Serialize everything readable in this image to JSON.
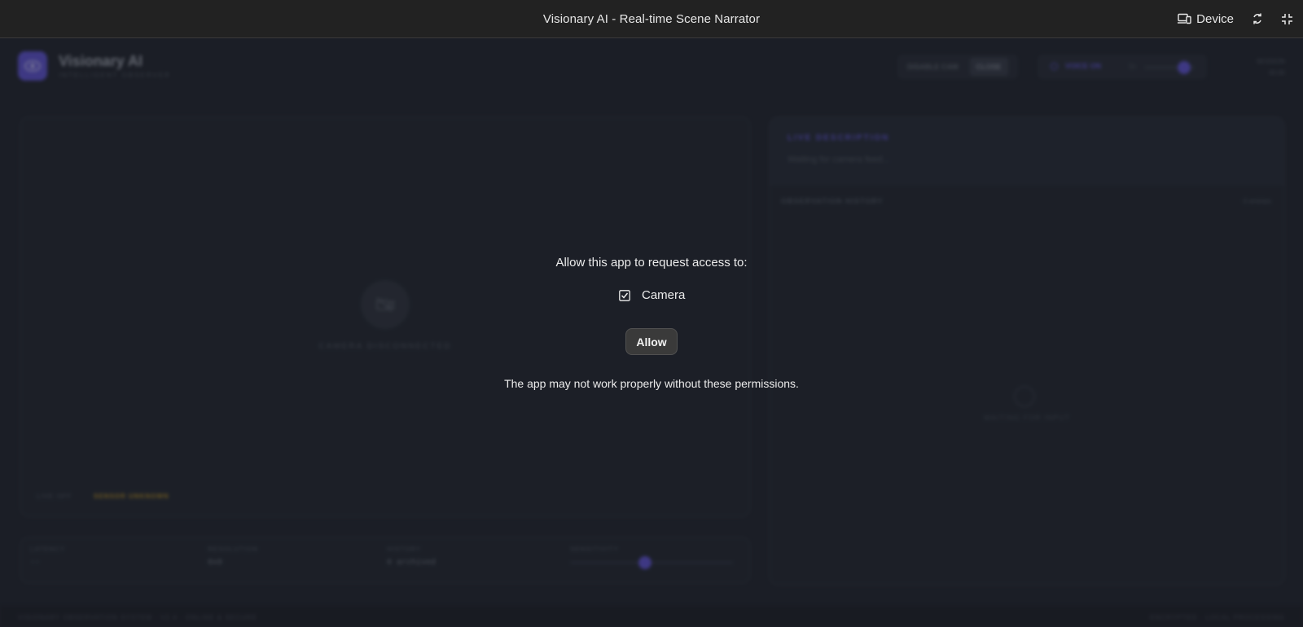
{
  "frame": {
    "title": "Visionary AI - Real-time Scene Narrator",
    "device_label": "Device"
  },
  "app": {
    "brand_name": "Visionary AI",
    "brand_subtitle": "INTELLIGENT OBSERVER",
    "camera_toggle": {
      "options": [
        "DISABLE CAM",
        "CLOSE"
      ]
    },
    "voice_label": "VOICE ON",
    "voice_rate_label": "1x",
    "session_label": "SESSION",
    "session_value": "00:00",
    "camera": {
      "status_text": "CAMERA DISCONNECTED",
      "live_status": "LIVE OFF",
      "sensor_status": "SENSOR UNKNOWN"
    },
    "stats": [
      {
        "label": "LATENCY",
        "value": "--"
      },
      {
        "label": "RESOLUTION",
        "value": "0x0"
      },
      {
        "label": "HISTORY",
        "value": "0 archived"
      },
      {
        "label": "SENSITIVITY",
        "value": ""
      }
    ],
    "sensitivity_level": 0.46,
    "live_description_title": "LIVE DESCRIPTION",
    "live_description_text": "Waiting for camera feed...",
    "history_title": "OBSERVATION HISTORY",
    "history_count": "0 entries",
    "history_empty": "WAITING FOR INPUT",
    "footer_left": "VISIONARY OBSERVATION SYSTEM · V2.4 · ONLINE & SECURE",
    "footer_right": "ENCRYPTED · LOCAL PROCESSING"
  },
  "permission": {
    "heading": "Allow this app to request access to:",
    "items": [
      {
        "label": "Camera",
        "checked": true
      }
    ],
    "allow_label": "Allow",
    "note": "The app may not work properly without these permissions."
  },
  "colors": {
    "accent": "#5b4fd0",
    "warning": "#b58a1e",
    "background": "#1b1e26"
  }
}
